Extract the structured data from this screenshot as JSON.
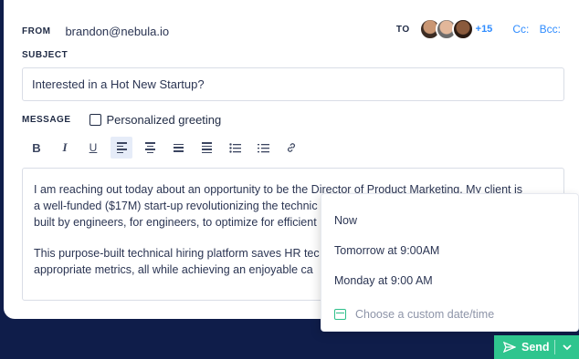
{
  "from": {
    "label": "FROM",
    "value": "brandon@nebula.io"
  },
  "to": {
    "label": "TO",
    "extra_count": "+15",
    "cc": "Cc:",
    "bcc": "Bcc:"
  },
  "subject": {
    "label": "SUBJECT",
    "value": "Interested in a Hot New Startup?"
  },
  "message": {
    "label": "MESSAGE",
    "personalized_label": "Personalized greeting",
    "personalized_checked": false
  },
  "toolbar": {
    "items": [
      "bold-icon",
      "italic-icon",
      "underline-icon",
      "align-left-icon",
      "align-center-icon",
      "align-right-icon",
      "align-justify-icon",
      "bullet-list-icon",
      "numbered-list-icon",
      "link-icon"
    ]
  },
  "body": {
    "p1_l1": "I am reaching out today about an opportunity to be the Director of Product Marketing. My client is",
    "p1_l2": "a well-funded ($17M) start-up revolutionizing the technic",
    "p1_l3": "built by engineers, for engineers, to optimize for efficient",
    "p2_l1": "This purpose-built technical hiring platform saves HR tec",
    "p2_l2": "appropriate metrics, all while achieving an enjoyable ca"
  },
  "schedule": {
    "options": [
      "Now",
      "Tomorrow at 9:00AM",
      "Monday at 9:00 AM"
    ],
    "custom": "Choose a custom date/time"
  },
  "send": {
    "label": "Send"
  },
  "colors": {
    "accent": "#2f8cff",
    "send_green": "#2fc58e",
    "background": "#0f1d4a"
  }
}
